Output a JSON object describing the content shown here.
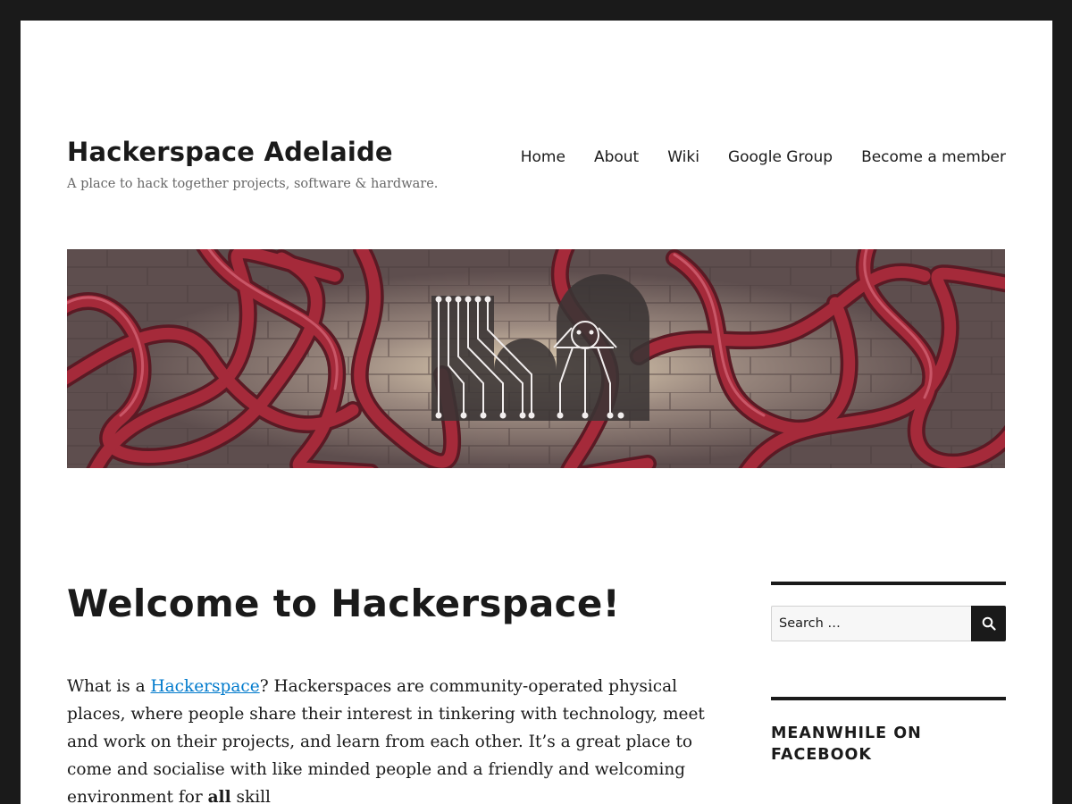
{
  "site": {
    "title": "Hackerspace Adelaide",
    "description": "A place to hack together projects, software & hardware."
  },
  "nav": {
    "items": [
      "Home",
      "About",
      "Wiki",
      "Google Group",
      "Become a member"
    ]
  },
  "banner": {
    "subject": "Hackerspace Adelaide logo over red tangled cables on brick wall",
    "colors": {
      "cable": "#8a2230",
      "wall": "#7a6a66",
      "logo": "#3d3838"
    }
  },
  "post": {
    "title": "Welcome to Hackerspace!",
    "intro_before_link": "What is a ",
    "intro_link": "Hackerspace",
    "intro_after_link": "? Hackerspaces are community-operated physical places, where people share their interest in tinkering with technology, meet and work on their projects, and learn from each other. It’s a great place to come and socialise with like minded people and a friendly and welcoming environment for ",
    "intro_bold": "all",
    "intro_end": " skill"
  },
  "sidebar": {
    "search_placeholder": "Search …",
    "search_icon": "search-icon",
    "widget_title": "Meanwhile on Facebook"
  },
  "colors": {
    "link": "#007acc",
    "text": "#1a1a1a",
    "frame": "#1a1a1a"
  }
}
